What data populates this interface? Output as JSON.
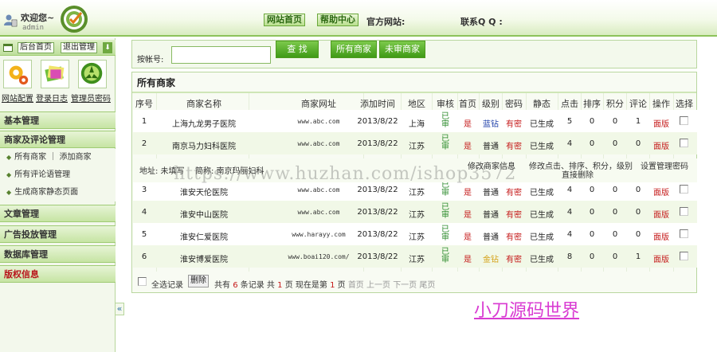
{
  "header": {
    "welcome": "欢迎您~",
    "username": "admin",
    "nav": [
      {
        "label": "网站首页"
      },
      {
        "label": "帮助中心"
      }
    ],
    "site_label": "官方网站:",
    "qq_label": "联系Q Q :"
  },
  "sidebar": {
    "top_buttons": [
      {
        "label": "后台首页"
      },
      {
        "label": "退出管理"
      }
    ],
    "quick_links": [
      {
        "label": "网站配置",
        "icon": "gear-icon"
      },
      {
        "label": "登录日志",
        "icon": "log-icon"
      },
      {
        "label": "管理员密码",
        "icon": "password-icon"
      }
    ],
    "sections": [
      {
        "label": "基本管理"
      },
      {
        "label": "商家及评论管理",
        "items": [
          {
            "label": "所有商家 ｜ 添加商家"
          },
          {
            "label": "所有评论语管理"
          },
          {
            "label": "生成商家静态页面"
          }
        ]
      },
      {
        "label": "文章管理"
      },
      {
        "label": "广告投放管理"
      },
      {
        "label": "数据库管理"
      },
      {
        "label": "版权信息"
      }
    ],
    "collapse_glyph": "«"
  },
  "search": {
    "label": "按帐号:",
    "value": "",
    "placeholder": "",
    "buttons": [
      {
        "label": "查 找"
      },
      {
        "label": "所有商家"
      },
      {
        "label": "未审商家"
      }
    ]
  },
  "list": {
    "title": "所有商家",
    "columns": [
      "序号",
      "商家名称",
      "商家网址",
      "添加时间",
      "地区",
      "审核",
      "首页",
      "级别",
      "密码",
      "静态",
      "点击",
      "排序",
      "积分",
      "评论",
      "操作",
      "选择"
    ],
    "rows": [
      {
        "no": "1",
        "name": "上海九龙男子医院",
        "url": "www.abc.com",
        "date": "2013/8/22",
        "region": "上海",
        "audit": "已审",
        "home": "是",
        "level": "蓝钻",
        "level_color": "blue",
        "password": "有密",
        "static": "已生成",
        "clicks": "5",
        "sort": "0",
        "points": "0",
        "comments": "1",
        "action": "面版"
      },
      {
        "no": "2",
        "name": "南京马力妇科医院",
        "url": "www.abc.com",
        "date": "2013/8/22",
        "region": "江苏",
        "audit": "已审",
        "home": "是",
        "level": "普通",
        "level_color": "dark",
        "password": "有密",
        "static": "已生成",
        "clicks": "4",
        "sort": "0",
        "points": "0",
        "comments": "0",
        "action": "面版"
      },
      {
        "no": "3",
        "name": "淮安天伦医院",
        "url": "www.abc.com",
        "date": "2013/8/22",
        "region": "江苏",
        "audit": "已审",
        "home": "是",
        "level": "普通",
        "level_color": "dark",
        "password": "有密",
        "static": "已生成",
        "clicks": "4",
        "sort": "0",
        "points": "0",
        "comments": "0",
        "action": "面版"
      },
      {
        "no": "4",
        "name": "淮安中山医院",
        "url": "www.abc.com",
        "date": "2013/8/22",
        "region": "江苏",
        "audit": "已审",
        "home": "是",
        "level": "普通",
        "level_color": "dark",
        "password": "有密",
        "static": "已生成",
        "clicks": "4",
        "sort": "0",
        "points": "0",
        "comments": "0",
        "action": "面版"
      },
      {
        "no": "5",
        "name": "淮安仁爱医院",
        "url": "www.harayy.com",
        "date": "2013/8/22",
        "region": "江苏",
        "audit": "已审",
        "home": "是",
        "level": "普通",
        "level_color": "dark",
        "password": "有密",
        "static": "已生成",
        "clicks": "4",
        "sort": "0",
        "points": "0",
        "comments": "0",
        "action": "面版"
      },
      {
        "no": "6",
        "name": "淮安博爱医院",
        "url": "www.boai120.com/",
        "date": "2013/8/22",
        "region": "江苏",
        "audit": "已审",
        "home": "是",
        "level": "金钻",
        "level_color": "gold",
        "password": "有密",
        "static": "已生成",
        "clicks": "8",
        "sort": "0",
        "points": "0",
        "comments": "1",
        "action": "面版"
      }
    ],
    "detail": {
      "address": "地址: 未填写",
      "short_name": "简称: 南京玛丽妇科",
      "edit_info": "修改商家信息",
      "edit_stats_line1": "修改点击、排序、积分，级别",
      "edit_stats_line2": "直接删除",
      "set_password": "设置管理密码"
    },
    "footer": {
      "select_all": "全选记录",
      "delete": "删除",
      "total_prefix": "共有",
      "total_count": "6",
      "total_suffix": "条记录 共",
      "pages": "1",
      "pages_suffix": "页 现在是第",
      "current_page": "1",
      "current_suffix": "页",
      "first": "首页",
      "prev": "上一页",
      "next": "下一页",
      "last": "尾页"
    }
  },
  "watermark": "https://www.huzhan.com/ishop3572",
  "brand_text": "小刀源码世界"
}
